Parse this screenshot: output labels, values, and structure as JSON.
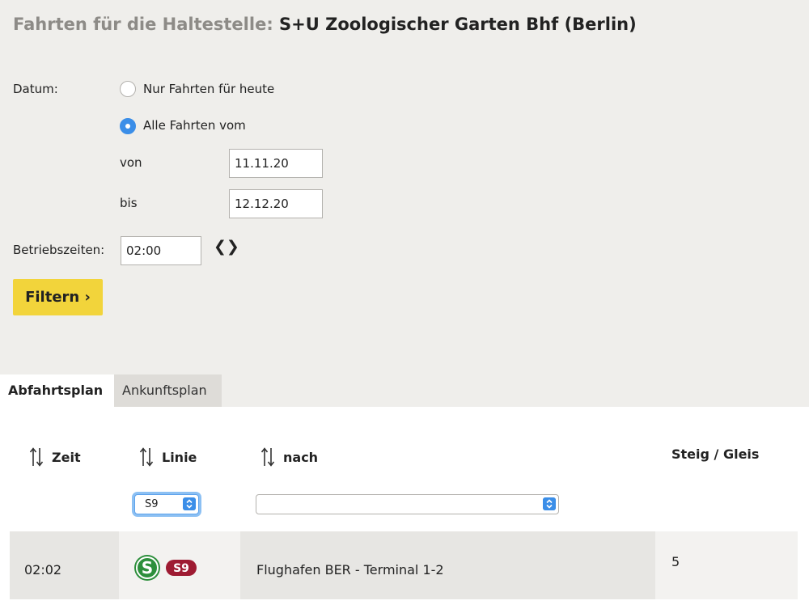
{
  "header": {
    "title_prefix": "Fahrten für die Haltestelle:",
    "title_station": "S+U Zoologischer Garten Bhf (Berlin)"
  },
  "form": {
    "date_label": "Datum:",
    "radio_today_label": "Nur Fahrten für heute",
    "radio_range_label": "Alle Fahrten vom",
    "selected_radio": "range",
    "from_label": "von",
    "from_value": "11.11.20",
    "to_label": "bis",
    "to_value": "12.12.20",
    "hours_label": "Betriebszeiten:",
    "hours_value": "02:00",
    "filter_label": "Filtern ›"
  },
  "tabs": [
    {
      "label": "Abfahrtsplan",
      "active": true
    },
    {
      "label": "Ankunftsplan",
      "active": false
    }
  ],
  "table": {
    "headers": {
      "time": "Zeit",
      "line": "Linie",
      "destination": "nach",
      "platform": "Steig / Gleis"
    },
    "filters": {
      "line_value": "S9",
      "destination_value": ""
    },
    "rows": [
      {
        "time": "02:02",
        "line_badge": "S9",
        "line_icon": "s-bahn-logo-icon",
        "destination": "Flughafen BER - Terminal 1-2",
        "platform": "5"
      }
    ]
  },
  "colors": {
    "accent_yellow": "#f2d43b",
    "select_blue": "#3b8ee8",
    "sbahn_green": "#2d8f3c",
    "s9_badge": "#9e1b32"
  }
}
